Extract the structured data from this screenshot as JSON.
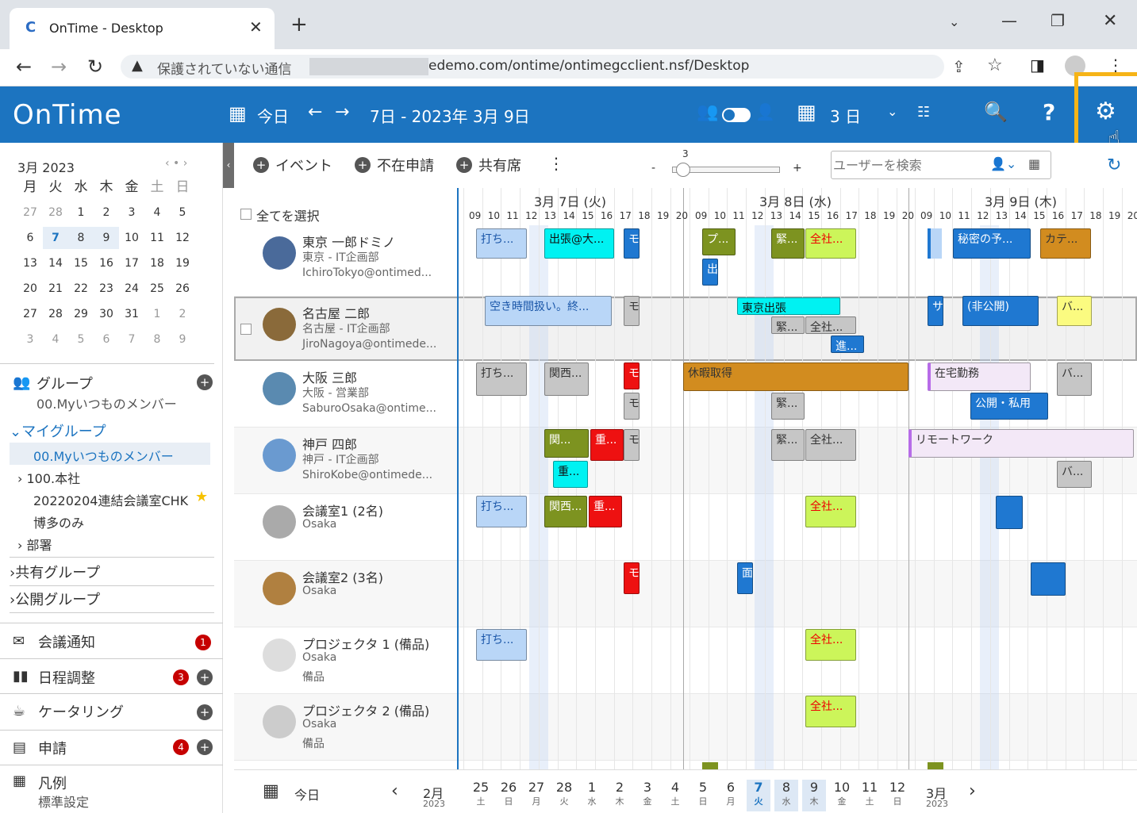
{
  "browser": {
    "tab_title": "OnTime - Desktop",
    "security": "保護されていない通信",
    "url": "edemo.com/ontime/ontimegcclient.nsf/Desktop"
  },
  "app": {
    "logo": "OnTime",
    "today": "今日",
    "date_range": "7日 - 2023年 3月 9日",
    "view_days": "3 日",
    "help": "?"
  },
  "toolbar": {
    "event": "イベント",
    "absence": "不在申請",
    "shared": "共有席",
    "zoom_value": "3",
    "zoom_minus": "-",
    "zoom_plus": "+",
    "search_placeholder": "ユーザーを検索"
  },
  "calendar": {
    "month": "3月 2023",
    "weekdays": [
      "月",
      "火",
      "水",
      "木",
      "金",
      "土",
      "日"
    ],
    "weeks": [
      [
        "27",
        "28",
        "1",
        "2",
        "3",
        "4",
        "5"
      ],
      [
        "6",
        "7",
        "8",
        "9",
        "10",
        "11",
        "12"
      ],
      [
        "13",
        "14",
        "15",
        "16",
        "17",
        "18",
        "19"
      ],
      [
        "20",
        "21",
        "22",
        "23",
        "24",
        "25",
        "26"
      ],
      [
        "27",
        "28",
        "29",
        "30",
        "31",
        "1",
        "2"
      ],
      [
        "3",
        "4",
        "5",
        "6",
        "7",
        "8",
        "9"
      ]
    ]
  },
  "sidebar": {
    "groups_label": "グループ",
    "groups_sub": "00.Myいつものメンバー",
    "my_group": "マイグループ",
    "my_items": [
      "00.Myいつものメンバー",
      "100.本社",
      "20220204連結会議室CHK",
      "博多のみ",
      "部署"
    ],
    "shared_group": "共有グループ",
    "public_group": "公開グループ",
    "meeting": "会議通知",
    "meeting_badge": "1",
    "schedule": "日程調整",
    "schedule_badge": "3",
    "catering": "ケータリング",
    "request": "申請",
    "request_badge": "4",
    "legend": "凡例",
    "legend_sub": "標準設定"
  },
  "grid": {
    "select_all": "全てを選択",
    "days": [
      "3月 7日 (火)",
      "3月 8日 (水)",
      "3月 9日 (木)"
    ],
    "hours": [
      "09",
      "10",
      "11",
      "12",
      "13",
      "14",
      "15",
      "16",
      "17",
      "18",
      "19",
      "20"
    ]
  },
  "people": [
    {
      "name": "東京 一郎ドミノ",
      "dept": "東京 - IT企画部",
      "email": "IchiroTokyo@ontimed..."
    },
    {
      "name": "名古屋 二郎",
      "dept": "名古屋 - IT企画部",
      "email": "JiroNagoya@ontimede..."
    },
    {
      "name": "大阪 三郎",
      "dept": "大阪 - 営業部",
      "email": "SaburoOsaka@ontime..."
    },
    {
      "name": "神戸 四郎",
      "dept": "神戸 - IT企画部",
      "email": "ShiroKobe@ontimede..."
    },
    {
      "name": "会議室1 (2名)",
      "dept": "Osaka",
      "email": ""
    },
    {
      "name": "会議室2 (3名)",
      "dept": "Osaka",
      "email": ""
    },
    {
      "name": "プロジェクタ 1 (備品)",
      "dept": "Osaka",
      "email": "備品"
    },
    {
      "name": "プロジェクタ 2 (備品)",
      "dept": "Osaka",
      "email": "備品"
    }
  ],
  "events": {
    "e1": "打ち...",
    "e2": "出張@大...",
    "e3": "モ",
    "e4": "プ...",
    "e5": "出",
    "e6": "緊...",
    "e7": "全社...",
    "e8": "秘密の予...",
    "e9": "カテ...",
    "e10": "空き時間扱い。終...",
    "e11": "モ",
    "e12": "東京出張",
    "e13": "緊...",
    "e14": "全社...",
    "e15": "進...",
    "e16": "サ",
    "e17": "(非公開)",
    "e18": "バ...",
    "e19": "打ち...",
    "e20": "関西...",
    "e21": "モ",
    "e22": "モ",
    "e23": "休暇取得",
    "e24": "緊...",
    "e25": "在宅勤務",
    "e26": "公開・私用",
    "e27": "バ...",
    "e28": "関...",
    "e29": "重...",
    "e30": "モ",
    "e31": "重...",
    "e32": "緊...",
    "e33": "全社...",
    "e34": "リモートワーク",
    "e35": "バ...",
    "e36": "打ち...",
    "e37": "関西...",
    "e38": "重...",
    "e39": "全社...",
    "e40": "モ",
    "e41": "面",
    "e42": "打ち...",
    "e43": "全社...",
    "e44": "全社..."
  },
  "bottom": {
    "today": "今日",
    "months": [
      "2月",
      "3月"
    ],
    "year": "2023",
    "dates": [
      "25",
      "26",
      "27",
      "28",
      "1",
      "2",
      "3",
      "4",
      "5",
      "6",
      "7",
      "8",
      "9",
      "10",
      "11",
      "12"
    ],
    "dows": [
      "土",
      "日",
      "月",
      "火",
      "水",
      "木",
      "金",
      "土",
      "日",
      "月",
      "火",
      "水",
      "木",
      "金",
      "土",
      "日"
    ]
  }
}
